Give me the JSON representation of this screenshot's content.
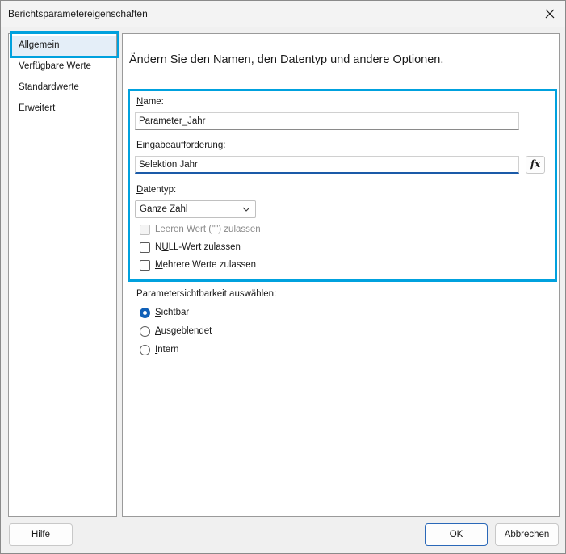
{
  "window": {
    "title": "Berichtsparametereigenschaften"
  },
  "nav": {
    "items": [
      {
        "label": "Allgemein",
        "selected": true
      },
      {
        "label": "Verfügbare Werte",
        "selected": false
      },
      {
        "label": "Standardwerte",
        "selected": false
      },
      {
        "label": "Erweitert",
        "selected": false
      }
    ]
  },
  "main": {
    "heading": "Ändern Sie den Namen, den Datentyp und andere Optionen.",
    "name": {
      "access_key": "N",
      "label_rest": "ame:",
      "value": "Parameter_Jahr"
    },
    "prompt": {
      "access_key": "E",
      "label_rest": "ingabeaufforderung:",
      "value": "Selektion Jahr",
      "expression_button": "fx"
    },
    "datatype": {
      "access_key": "D",
      "label_rest": "atentyp:",
      "value": "Ganze Zahl"
    },
    "options": {
      "allow_blank": {
        "access_key": "L",
        "label_rest": "eeren Wert (\"\") zulassen",
        "checked": false,
        "enabled": false
      },
      "allow_null": {
        "label_before": "N",
        "access_key": "U",
        "label_rest": "LL-Wert zulassen",
        "checked": false,
        "enabled": true
      },
      "allow_multiple": {
        "access_key": "M",
        "label_rest": "ehrere Werte zulassen",
        "checked": false,
        "enabled": true
      }
    },
    "visibility": {
      "label": "Parametersichtbarkeit auswählen:",
      "options": [
        {
          "access_key": "S",
          "label_rest": "ichtbar",
          "checked": true
        },
        {
          "access_key": "A",
          "label_rest": "usgeblendet",
          "checked": false
        },
        {
          "access_key": "I",
          "label_rest": "ntern",
          "checked": false
        }
      ]
    }
  },
  "footer": {
    "help": "Hilfe",
    "ok": "OK",
    "cancel": "Abbrechen"
  },
  "colors": {
    "highlight": "#00a1de",
    "radio_selected": "#1060b8",
    "nav_selected_bg": "#e4eef8"
  }
}
